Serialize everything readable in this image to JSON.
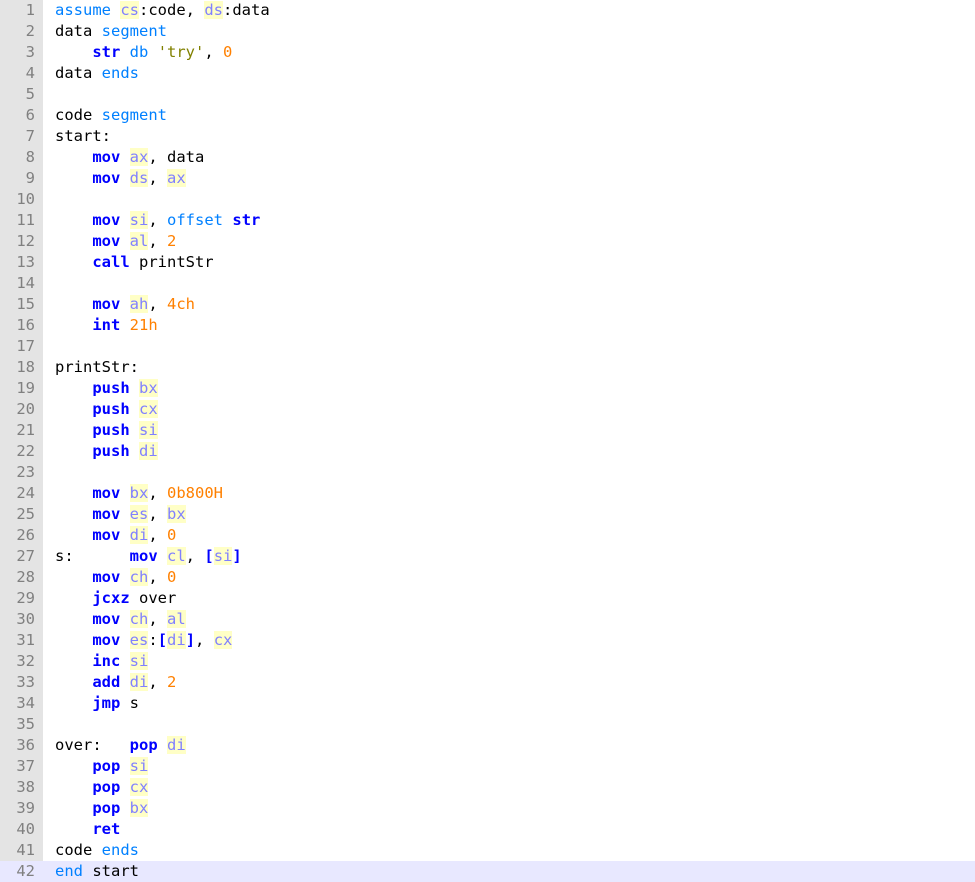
{
  "editor": {
    "lines": [
      {
        "n": "1",
        "tokens": [
          [
            "dir",
            "assume"
          ],
          [
            "plain",
            " "
          ],
          [
            "reg",
            "cs"
          ],
          [
            "plain",
            ":code, "
          ],
          [
            "reg",
            "ds"
          ],
          [
            "plain",
            ":data"
          ]
        ]
      },
      {
        "n": "2",
        "tokens": [
          [
            "plain",
            "data "
          ],
          [
            "dir",
            "segment"
          ]
        ]
      },
      {
        "n": "3",
        "tokens": [
          [
            "plain",
            "    "
          ],
          [
            "kw",
            "str"
          ],
          [
            "plain",
            " "
          ],
          [
            "dir",
            "db"
          ],
          [
            "plain",
            " "
          ],
          [
            "str",
            "'try'"
          ],
          [
            "plain",
            ", "
          ],
          [
            "num-lit",
            "0"
          ]
        ]
      },
      {
        "n": "4",
        "tokens": [
          [
            "plain",
            "data "
          ],
          [
            "dir",
            "ends"
          ]
        ]
      },
      {
        "n": "5",
        "tokens": []
      },
      {
        "n": "6",
        "tokens": [
          [
            "plain",
            "code "
          ],
          [
            "dir",
            "segment"
          ]
        ]
      },
      {
        "n": "7",
        "tokens": [
          [
            "plain",
            "start:"
          ]
        ]
      },
      {
        "n": "8",
        "tokens": [
          [
            "plain",
            "    "
          ],
          [
            "kw",
            "mov"
          ],
          [
            "plain",
            " "
          ],
          [
            "reg",
            "ax"
          ],
          [
            "plain",
            ", data"
          ]
        ]
      },
      {
        "n": "9",
        "tokens": [
          [
            "plain",
            "    "
          ],
          [
            "kw",
            "mov"
          ],
          [
            "plain",
            " "
          ],
          [
            "reg",
            "ds"
          ],
          [
            "plain",
            ", "
          ],
          [
            "reg",
            "ax"
          ]
        ]
      },
      {
        "n": "10",
        "tokens": []
      },
      {
        "n": "11",
        "tokens": [
          [
            "plain",
            "    "
          ],
          [
            "kw",
            "mov"
          ],
          [
            "plain",
            " "
          ],
          [
            "reg",
            "si"
          ],
          [
            "plain",
            ", "
          ],
          [
            "dir",
            "offset"
          ],
          [
            "plain",
            " "
          ],
          [
            "kw",
            "str"
          ]
        ]
      },
      {
        "n": "12",
        "tokens": [
          [
            "plain",
            "    "
          ],
          [
            "kw",
            "mov"
          ],
          [
            "plain",
            " "
          ],
          [
            "reg",
            "al"
          ],
          [
            "plain",
            ", "
          ],
          [
            "num-lit",
            "2"
          ]
        ]
      },
      {
        "n": "13",
        "tokens": [
          [
            "plain",
            "    "
          ],
          [
            "kw",
            "call"
          ],
          [
            "plain",
            " printStr"
          ]
        ]
      },
      {
        "n": "14",
        "tokens": []
      },
      {
        "n": "15",
        "tokens": [
          [
            "plain",
            "    "
          ],
          [
            "kw",
            "mov"
          ],
          [
            "plain",
            " "
          ],
          [
            "reg",
            "ah"
          ],
          [
            "plain",
            ", "
          ],
          [
            "num-lit",
            "4ch"
          ]
        ]
      },
      {
        "n": "16",
        "tokens": [
          [
            "plain",
            "    "
          ],
          [
            "kw",
            "int"
          ],
          [
            "plain",
            " "
          ],
          [
            "num-lit",
            "21h"
          ]
        ]
      },
      {
        "n": "17",
        "tokens": []
      },
      {
        "n": "18",
        "tokens": [
          [
            "plain",
            "printStr:"
          ]
        ]
      },
      {
        "n": "19",
        "tokens": [
          [
            "plain",
            "    "
          ],
          [
            "kw",
            "push"
          ],
          [
            "plain",
            " "
          ],
          [
            "reg",
            "bx"
          ]
        ]
      },
      {
        "n": "20",
        "tokens": [
          [
            "plain",
            "    "
          ],
          [
            "kw",
            "push"
          ],
          [
            "plain",
            " "
          ],
          [
            "reg",
            "cx"
          ]
        ]
      },
      {
        "n": "21",
        "tokens": [
          [
            "plain",
            "    "
          ],
          [
            "kw",
            "push"
          ],
          [
            "plain",
            " "
          ],
          [
            "reg",
            "si"
          ]
        ]
      },
      {
        "n": "22",
        "tokens": [
          [
            "plain",
            "    "
          ],
          [
            "kw",
            "push"
          ],
          [
            "plain",
            " "
          ],
          [
            "reg",
            "di"
          ]
        ]
      },
      {
        "n": "23",
        "tokens": []
      },
      {
        "n": "24",
        "tokens": [
          [
            "plain",
            "    "
          ],
          [
            "kw",
            "mov"
          ],
          [
            "plain",
            " "
          ],
          [
            "reg",
            "bx"
          ],
          [
            "plain",
            ", "
          ],
          [
            "num-lit",
            "0b800H"
          ]
        ]
      },
      {
        "n": "25",
        "tokens": [
          [
            "plain",
            "    "
          ],
          [
            "kw",
            "mov"
          ],
          [
            "plain",
            " "
          ],
          [
            "reg",
            "es"
          ],
          [
            "plain",
            ", "
          ],
          [
            "reg",
            "bx"
          ]
        ]
      },
      {
        "n": "26",
        "tokens": [
          [
            "plain",
            "    "
          ],
          [
            "kw",
            "mov"
          ],
          [
            "plain",
            " "
          ],
          [
            "reg",
            "di"
          ],
          [
            "plain",
            ", "
          ],
          [
            "num-lit",
            "0"
          ]
        ]
      },
      {
        "n": "27",
        "tokens": [
          [
            "plain",
            "s:      "
          ],
          [
            "kw",
            "mov"
          ],
          [
            "plain",
            " "
          ],
          [
            "reg",
            "cl"
          ],
          [
            "plain",
            ", "
          ],
          [
            "kw",
            "["
          ],
          [
            "reg",
            "si"
          ],
          [
            "kw",
            "]"
          ]
        ]
      },
      {
        "n": "28",
        "tokens": [
          [
            "plain",
            "    "
          ],
          [
            "kw",
            "mov"
          ],
          [
            "plain",
            " "
          ],
          [
            "reg",
            "ch"
          ],
          [
            "plain",
            ", "
          ],
          [
            "num-lit",
            "0"
          ]
        ]
      },
      {
        "n": "29",
        "tokens": [
          [
            "plain",
            "    "
          ],
          [
            "kw",
            "jcxz"
          ],
          [
            "plain",
            " over"
          ]
        ]
      },
      {
        "n": "30",
        "tokens": [
          [
            "plain",
            "    "
          ],
          [
            "kw",
            "mov"
          ],
          [
            "plain",
            " "
          ],
          [
            "reg",
            "ch"
          ],
          [
            "plain",
            ", "
          ],
          [
            "reg",
            "al"
          ]
        ]
      },
      {
        "n": "31",
        "tokens": [
          [
            "plain",
            "    "
          ],
          [
            "kw",
            "mov"
          ],
          [
            "plain",
            " "
          ],
          [
            "reg",
            "es"
          ],
          [
            "plain",
            ":"
          ],
          [
            "kw",
            "["
          ],
          [
            "reg",
            "di"
          ],
          [
            "kw",
            "]"
          ],
          [
            "plain",
            ", "
          ],
          [
            "reg",
            "cx"
          ]
        ]
      },
      {
        "n": "32",
        "tokens": [
          [
            "plain",
            "    "
          ],
          [
            "kw",
            "inc"
          ],
          [
            "plain",
            " "
          ],
          [
            "reg",
            "si"
          ]
        ]
      },
      {
        "n": "33",
        "tokens": [
          [
            "plain",
            "    "
          ],
          [
            "kw",
            "add"
          ],
          [
            "plain",
            " "
          ],
          [
            "reg",
            "di"
          ],
          [
            "plain",
            ", "
          ],
          [
            "num-lit",
            "2"
          ]
        ]
      },
      {
        "n": "34",
        "tokens": [
          [
            "plain",
            "    "
          ],
          [
            "kw",
            "jmp"
          ],
          [
            "plain",
            " s"
          ]
        ]
      },
      {
        "n": "35",
        "tokens": []
      },
      {
        "n": "36",
        "tokens": [
          [
            "plain",
            "over:   "
          ],
          [
            "kw",
            "pop"
          ],
          [
            "plain",
            " "
          ],
          [
            "reg",
            "di"
          ]
        ]
      },
      {
        "n": "37",
        "tokens": [
          [
            "plain",
            "    "
          ],
          [
            "kw",
            "pop"
          ],
          [
            "plain",
            " "
          ],
          [
            "reg",
            "si"
          ]
        ]
      },
      {
        "n": "38",
        "tokens": [
          [
            "plain",
            "    "
          ],
          [
            "kw",
            "pop"
          ],
          [
            "plain",
            " "
          ],
          [
            "reg",
            "cx"
          ]
        ]
      },
      {
        "n": "39",
        "tokens": [
          [
            "plain",
            "    "
          ],
          [
            "kw",
            "pop"
          ],
          [
            "plain",
            " "
          ],
          [
            "reg",
            "bx"
          ]
        ]
      },
      {
        "n": "40",
        "tokens": [
          [
            "plain",
            "    "
          ],
          [
            "kw",
            "ret"
          ]
        ]
      },
      {
        "n": "41",
        "tokens": [
          [
            "plain",
            "code "
          ],
          [
            "dir",
            "ends"
          ]
        ]
      },
      {
        "n": "42",
        "tokens": [
          [
            "dir",
            "end"
          ],
          [
            "plain",
            " start"
          ]
        ],
        "current": true
      }
    ]
  },
  "colors": {
    "keyword": "#0000ff",
    "directive": "#0080ff",
    "register": "#8080ff",
    "register_bg": "#ffffc6",
    "number": "#ff8000",
    "string": "#808000",
    "gutter_bg": "#e4e4e4",
    "line_number": "#808080",
    "current_line_bg": "#e8e8ff"
  }
}
